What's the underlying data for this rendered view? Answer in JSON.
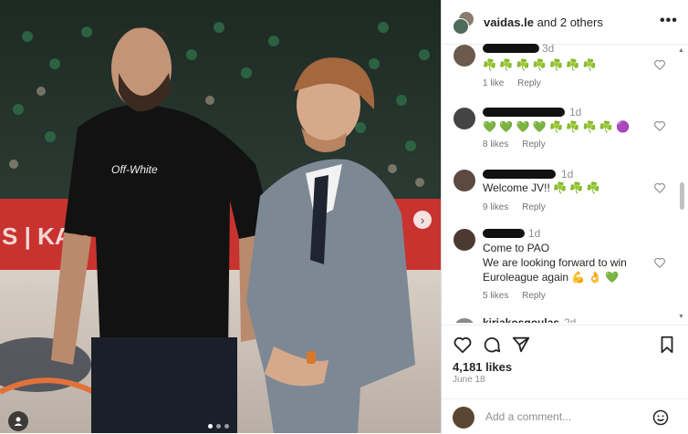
{
  "post": {
    "author": "vaidas.le",
    "coauthors_text": "and 2 others",
    "likes_text": "4,181 likes",
    "date_text": "June 18",
    "carousel": {
      "total": 3,
      "current": 1
    }
  },
  "comments": [
    {
      "time": "3d",
      "text": "☘️ ☘️ ☘️ ☘️ ☘️ ☘️ ☘️",
      "likes": "1 like",
      "reply": "Reply"
    },
    {
      "time": "1d",
      "text": "💚 💚 💚 💚 ☘️ ☘️ ☘️ ☘️ 🟣",
      "likes": "8 likes",
      "reply": "Reply"
    },
    {
      "time": "1d",
      "text": "Welcome JV!! ☘️ ☘️ ☘️",
      "likes": "9 likes",
      "reply": "Reply"
    },
    {
      "time": "1d",
      "text": "Come to PAO\nWe are looking forward to win\nEuroleague again 💪 👌 💚",
      "likes": "5 likes",
      "reply": "Reply"
    },
    {
      "username": "kiriakosgoulas",
      "time": "2d"
    }
  ],
  "add_comment": {
    "placeholder": "Add a comment..."
  },
  "icons": {
    "like": "heart-icon",
    "comment": "comment-icon",
    "share": "share-icon",
    "save": "bookmark-icon",
    "emoji": "smiley-icon",
    "more": "more-options-icon",
    "tag": "user-tag-icon",
    "next": "chevron-right-icon"
  },
  "colors": {
    "clover": "#1a9b3a",
    "text": "#262626",
    "muted": "#8e8e8e"
  }
}
